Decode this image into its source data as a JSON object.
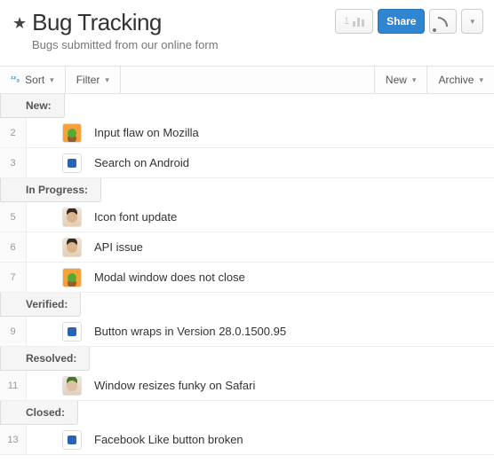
{
  "header": {
    "title": "Bug Tracking",
    "subtitle": "Bugs submitted from our online form",
    "starred": true,
    "org_count": "1"
  },
  "top_actions": {
    "share": "Share"
  },
  "toolbar": {
    "sort": "Sort",
    "filter": "Filter",
    "new": "New",
    "archive": "Archive"
  },
  "groups": [
    {
      "label": "New:",
      "rows": [
        {
          "num": "2",
          "avatar": "orange",
          "title": "Input flaw on Mozilla"
        },
        {
          "num": "3",
          "avatar": "block",
          "title": "Search on Android"
        }
      ]
    },
    {
      "label": "In Progress:",
      "rows": [
        {
          "num": "5",
          "avatar": "face1",
          "title": "Icon font update"
        },
        {
          "num": "6",
          "avatar": "face1",
          "title": "API issue"
        },
        {
          "num": "7",
          "avatar": "orange",
          "title": "Modal window does not close"
        }
      ]
    },
    {
      "label": "Verified:",
      "rows": [
        {
          "num": "9",
          "avatar": "block",
          "title": "Button wraps in Version 28.0.1500.95"
        }
      ]
    },
    {
      "label": "Resolved:",
      "rows": [
        {
          "num": "11",
          "avatar": "face2",
          "title": "Window resizes funky on Safari"
        }
      ]
    },
    {
      "label": "Closed:",
      "rows": [
        {
          "num": "13",
          "avatar": "block",
          "title": "Facebook Like button broken"
        }
      ]
    }
  ]
}
